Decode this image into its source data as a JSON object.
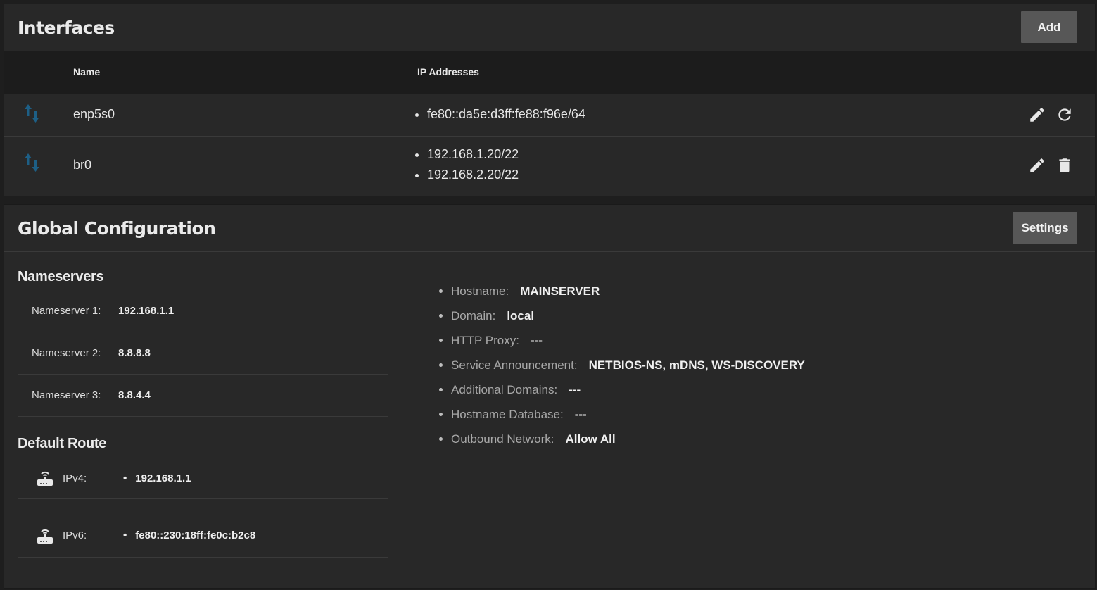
{
  "interfaces": {
    "title": "Interfaces",
    "add_label": "Add",
    "columns": {
      "name": "Name",
      "ip": "IP Addresses"
    },
    "rows": [
      {
        "name": "enp5s0",
        "ips": [
          "fe80::da5e:d3ff:fe88:f96e/64"
        ],
        "actions": [
          "edit-icon",
          "refresh-icon"
        ]
      },
      {
        "name": "br0",
        "ips": [
          "192.168.1.20/22",
          "192.168.2.20/22"
        ],
        "actions": [
          "edit-icon",
          "delete-icon"
        ]
      }
    ]
  },
  "global": {
    "title": "Global Configuration",
    "settings_label": "Settings",
    "nameservers": {
      "title": "Nameservers",
      "items": [
        {
          "label": "Nameserver 1:",
          "value": "192.168.1.1"
        },
        {
          "label": "Nameserver 2:",
          "value": "8.8.8.8"
        },
        {
          "label": "Nameserver 3:",
          "value": "8.8.4.4"
        }
      ]
    },
    "default_route": {
      "title": "Default Route",
      "items": [
        {
          "label": "IPv4:",
          "value": "192.168.1.1"
        },
        {
          "label": "IPv6:",
          "value": "fe80::230:18ff:fe0c:b2c8"
        }
      ]
    },
    "properties": [
      {
        "label": "Hostname:",
        "value": "MAINSERVER"
      },
      {
        "label": "Domain:",
        "value": "local"
      },
      {
        "label": "HTTP Proxy:",
        "value": "---"
      },
      {
        "label": "Service Announcement:",
        "value": "NETBIOS-NS, mDNS, WS-DISCOVERY"
      },
      {
        "label": "Additional Domains:",
        "value": "---"
      },
      {
        "label": "Hostname Database:",
        "value": "---"
      },
      {
        "label": "Outbound Network:",
        "value": "Allow All"
      }
    ]
  },
  "colors": {
    "icon_blue": "#1d5f86",
    "icon_light": "#e8e8e8",
    "background": "#282828"
  }
}
